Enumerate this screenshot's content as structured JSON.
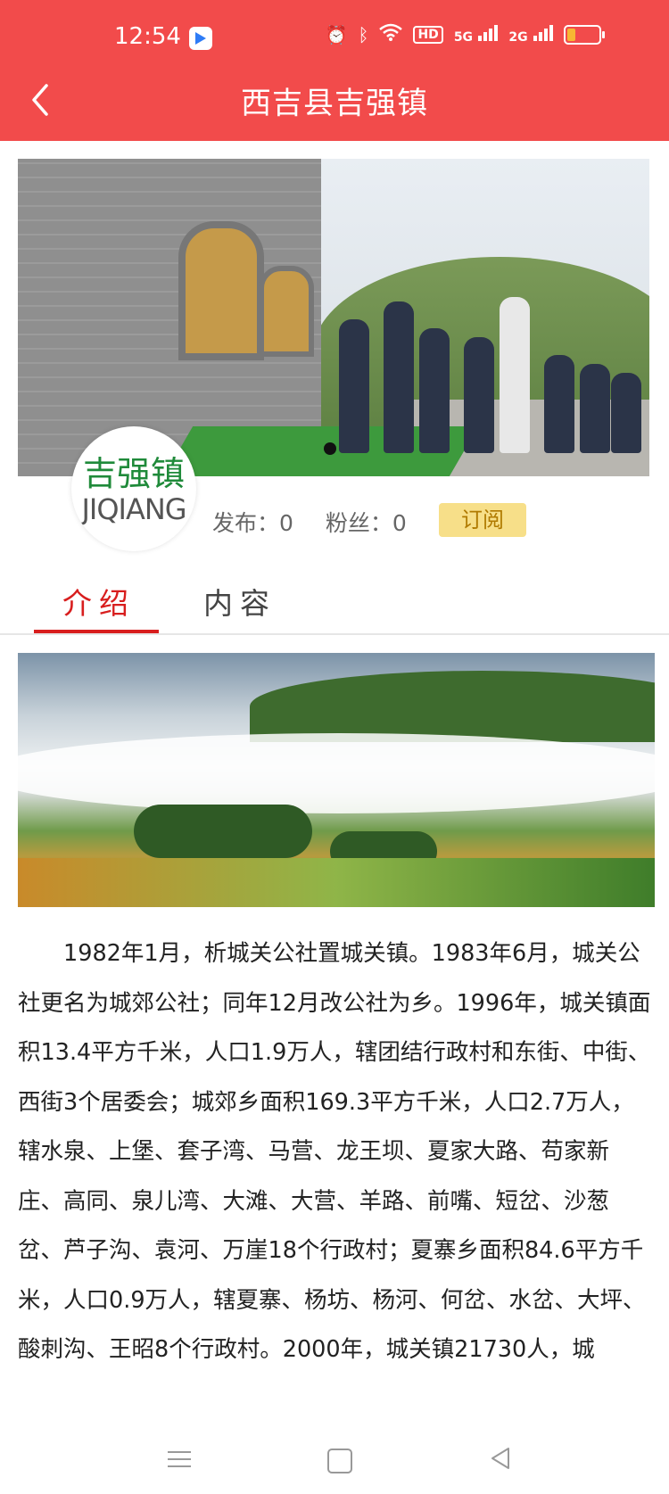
{
  "status_bar": {
    "time": "12:54",
    "network": "5G",
    "network2": "2G",
    "hd": "HD",
    "battery_level": 0.25
  },
  "header": {
    "title": "西吉县吉强镇",
    "back_icon": "chevron-left-icon",
    "bg_color": "#f24b4b"
  },
  "banner": {
    "active_slide": 1,
    "slide_count": 1
  },
  "profile": {
    "logo_cn": "吉强镇",
    "logo_en": "JIQIANG",
    "posts_label": "发布：0",
    "fans_label": "粉丝：0",
    "subscribe_label": "订阅"
  },
  "tabs": [
    {
      "label": "介绍",
      "active": true
    },
    {
      "label": "内容",
      "active": false
    }
  ],
  "accent_color": "#d81e1e",
  "article": {
    "text": "1982年1月，析城关公社置城关镇。1983年6月，城关公社更名为城郊公社；同年12月改公社为乡。1996年，城关镇面积13.4平方千米，人口1.9万人，辖团结行政村和东街、中街、西街3个居委会；城郊乡面积169.3平方千米，人口2.7万人，辖水泉、上堡、套子湾、马营、龙王坝、夏家大路、苟家新庄、高同、泉儿湾、大滩、大营、羊路、前嘴、短岔、沙葱岔、芦子沟、袁河、万崖18个行政村；夏寨乡面积84.6平方千米，人口0.9万人，辖夏寨、杨坊、杨河、何岔、水岔、大坪、酸刺沟、王昭8个行政村。2000年，城关镇21730人，城"
  },
  "nav_bar": {
    "menu_icon": "menu-icon",
    "home_icon": "home-icon",
    "back_icon": "back-triangle-icon"
  }
}
